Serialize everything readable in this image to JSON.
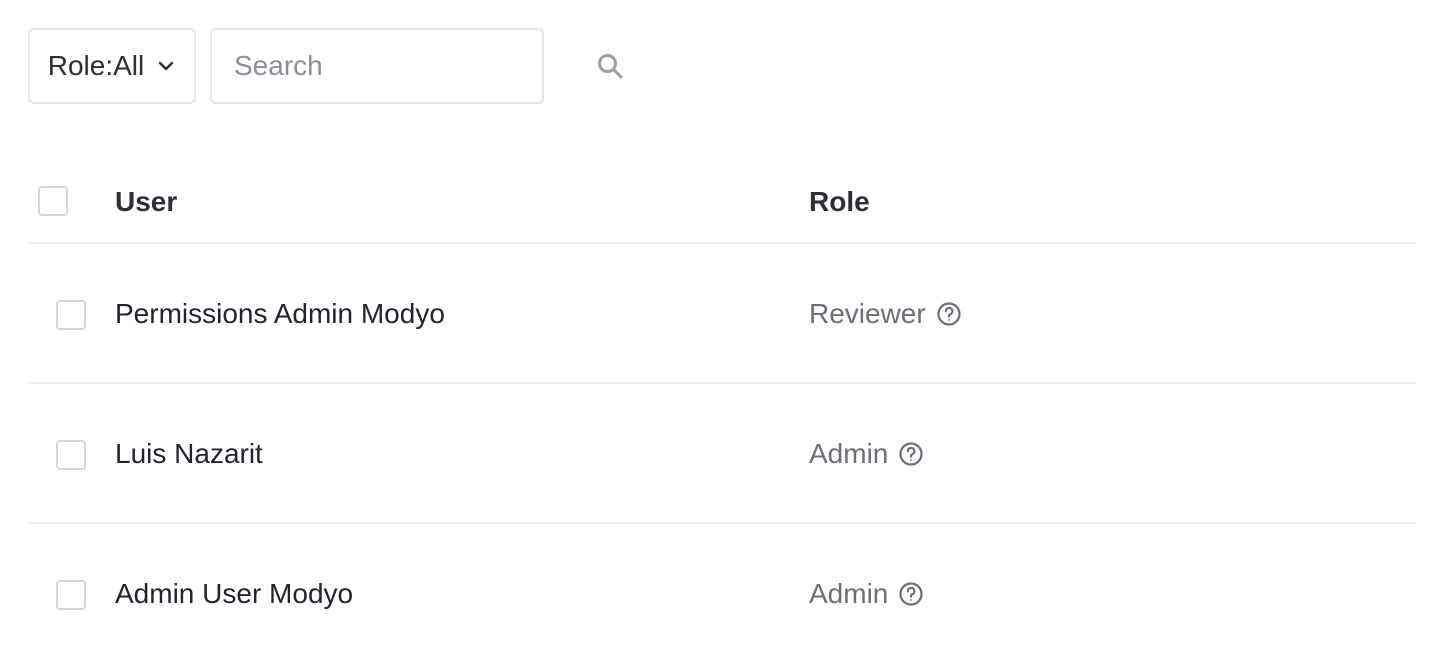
{
  "filters": {
    "role_filter_label": "Role:All",
    "search_placeholder": "Search"
  },
  "icons": {
    "dropdown": "chevron-down-icon",
    "search": "search-icon",
    "help": "help-circle-icon"
  },
  "table": {
    "columns": {
      "user": "User",
      "role": "Role"
    },
    "rows": [
      {
        "user": "Permissions Admin Modyo",
        "role": "Reviewer"
      },
      {
        "user": "Luis Nazarit",
        "role": "Admin"
      },
      {
        "user": "Admin User Modyo",
        "role": "Admin"
      }
    ]
  },
  "colors": {
    "border": "#e2e4e9",
    "divider": "#f0f1f4",
    "text_primary": "#1f2430",
    "text_secondary": "#6b6f78"
  }
}
